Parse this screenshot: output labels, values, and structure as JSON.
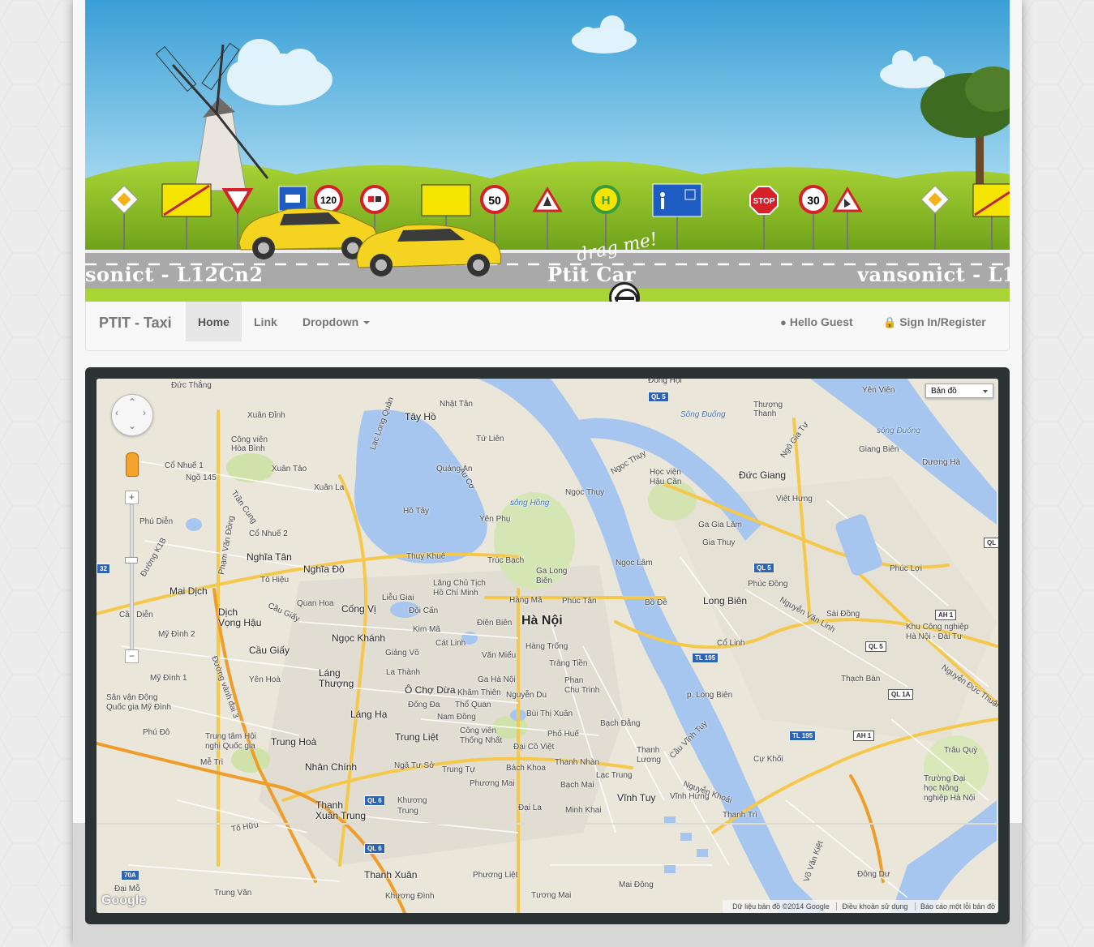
{
  "header": {
    "road_text_left": "sonict - L12Cn2",
    "road_text_mid": "Ptit Car",
    "road_text_right": "vansonict - L12",
    "drag_hint": "drag me!",
    "sign_labels": [
      "120",
      "50",
      "STOP",
      "30"
    ],
    "sign_label_h": "H"
  },
  "navbar": {
    "brand": "PTIT - Taxi",
    "items": [
      {
        "label": "Home",
        "active": true
      },
      {
        "label": "Link",
        "active": false
      },
      {
        "label": "Dropdown",
        "active": false
      }
    ],
    "right": [
      {
        "icon": "user-icon",
        "label": "Hello Guest"
      },
      {
        "icon": "lock-icon",
        "label": "Sign In/Register"
      }
    ]
  },
  "map": {
    "type_selector": "Bản đồ",
    "logo": "Google",
    "attribution": {
      "data": "Dữ liệu bản đồ ©2014 Google",
      "terms": "Điều khoản sử dụng",
      "report": "Báo cáo một lỗi bản đồ"
    },
    "labels": {
      "city": "Hà Nội",
      "long_bien": "Long Biên",
      "cau_giay": "Cầu Giấy",
      "tay_ho": "Tây Hồ",
      "duc_thang": "Đức Thắng",
      "xuan_dinh": "Xuân Đỉnh",
      "co_nhue": "Cổ Nhuế",
      "cong_vien_hoa_binh": "Công viên\nHòa Bình",
      "xuan_tao": "Xuân Tảo",
      "co_nhue_1": "Cổ Nhuế 1",
      "ngo_145": "Ngõ 145",
      "xuan_la": "Xuân La",
      "phu_dien": "Phú Diễn",
      "co_nhue_2": "Cổ Nhuế 2",
      "nghia_tan": "Nghĩa Tân",
      "nghia_do": "Nghĩa Đô",
      "to_hieu": "Tô Hiệu",
      "quan_hoa": "Quan Hoa",
      "cong_vi": "Cống Vị",
      "mai_dich": "Mai Dịch",
      "dich_vong_hau": "Dịch\nVọng Hậu",
      "cau_dien": "Cầu Diễn",
      "my_dinh_2": "Mỹ Đình 2",
      "my_dinh_1": "Mỹ Đình 1",
      "yen_hoa": "Yên Hoà",
      "svd_my_dinh": "Sân vận Động\nQuốc gia Mỹ Đình",
      "phu_do": "Phú Đô",
      "me_tri": "Mễ Trì",
      "trung_tam_hoi_nghi": "Trung tâm Hội\nnghị Quốc gia",
      "trung_hoa": "Trung Hoà",
      "nhan_chinh": "Nhân Chính",
      "thanh_xuan_trung": "Thanh\nXuân Trung",
      "thanh_xuan": "Thanh Xuân",
      "ngoc_khanh": "Ngọc Khánh",
      "giang_vo": "Giảng Võ",
      "lang_thuong": "Láng\nThượng",
      "la_thanh": "La Thành",
      "o_cho_dua": "Ô Chợ Dừa",
      "lang_ha": "Láng Hạ",
      "trung_liet": "Trung Liệt",
      "nga_tu_so": "Ngã Tư Sở",
      "trung_tu": "Trung Tự",
      "khuong_trung": "Khương\nTrung",
      "phuong_mai": "Phương Mai",
      "khuong_dinh": "Khương Đình",
      "phuong_liet": "Phương Liệt",
      "thuy_khue": "Thuỵ Khuê",
      "truc_bach": "Trúc Bạch",
      "lang_bac": "Lăng Chủ Tịch\nHồ Chí Minh",
      "lieu_giai": "Liễu Giai",
      "doi_can": "Đội Cấn",
      "kim_ma": "Kim Mã",
      "cat_linh": "Cát Linh",
      "dien_bien": "Điện Biên",
      "hang_ma": "Hàng Mã",
      "hang_trong": "Hàng Trống",
      "van_mieu": "Văn Miếu",
      "trang_tien": "Tràng Tiền",
      "ga_ha_noi": "Ga Hà Nội",
      "kham_thien": "Khâm Thiên",
      "nguyen_du": "Nguyễn Du",
      "tho_quan": "Thổ Quan",
      "nam_dong": "Nam Đồng",
      "bui_thi_xuan": "Bùi Thị Xuân",
      "phan_chu_trinh": "Phan\nChu Trinh",
      "pho_hue": "Phố Huế",
      "dong_da": "Đống Đa",
      "cong_vien_thong_nhat": "Công viên\nThống Nhất",
      "dai_co_viet": "Đại Cồ Việt",
      "bach_khoa": "Bách Khoa",
      "thanh_nhan": "Thanh Nhàn",
      "bach_mai": "Bạch Mai",
      "dai_la": "Đại La",
      "minh_khai": "Minh Khai",
      "lac_trung": "Lạc Trung",
      "vinh_tuy": "Vĩnh Tuy",
      "thanh_luong": "Thanh\nLương",
      "bach_dang": "Bạch Đằng",
      "ga_long_bien": "Ga Long\nBiên",
      "phuc_tan": "Phúc Tân",
      "yen_phu": "Yên Phụ",
      "quang_an": "Quảng An",
      "nhat_tan": "Nhật Tân",
      "tu_lien": "Tứ Liên",
      "ho_tay": "Hồ Tây",
      "ngoc_thuy": "Ngọc Thụy",
      "song_hong": "sông Hồng",
      "hoc_vien_hau_can": "Học viện\nHậu Cần",
      "duc_giang": "Đức Giang",
      "thuong_thanh": "Thượng\nThanh",
      "song_duong": "Sông Đuống",
      "song_duong_2": "sông Đuống",
      "giang_bien": "Giang Biên",
      "duong_ha": "Dương Hà",
      "yen_vien": "Yên Viên",
      "dong_hoi": "Đông Hội",
      "viet_hung": "Việt Hưng",
      "ga_gia_lam": "Ga Gia Lâm",
      "gia_thuy": "Gia Thuy",
      "ngoc_lam": "Ngọc Lâm",
      "phuc_dong": "Phúc Đồng",
      "bo_de": "Bồ Đề",
      "sai_dong": "Sài Đồng",
      "phuc_loi": "Phúc Lợi",
      "kcn_hanoi_dai_tu": "Khu Công nghiệp\nHà Nội - Đài Tư",
      "co_linh": "Cổ Linh",
      "thach_ban": "Thạch Bàn",
      "p_long_bien": "p. Long Biên",
      "cu_khoi": "Cự Khối",
      "trau_quy": "Trâu Quỳ",
      "dh_nong_nghiep": "Trường Đại\nhọc Nông\nnghiệp Hà Nội",
      "vinh_hung": "Vĩnh Hưng",
      "thanh_tri": "Thanh Trì",
      "mai_dong": "Mai Động",
      "tuong_mai": "Tương Mai",
      "dong_du": "Đông Dư",
      "nguyen_van_linh": "Nguyễn Văn Linh",
      "nguyen_duc_thuan": "Nguyễn Đức Thuận",
      "cau_vinh_tuy": "Cầu Vĩnh Tuy",
      "nguyen_khoai": "Nguyễn Khoái",
      "duong_vanh_dai_3": "Đường vành đai 3",
      "cau_giay_road": "Cầu Giấy",
      "to_huu": "Tố Hữu",
      "trung_van": "Trung Văn",
      "dai_mo": "Đại Mỗ",
      "lac_long_quan": "Lạc Long Quân",
      "au_co": "Âu Cơ",
      "tran_cung": "Trần Cung",
      "pham_van_dong": "Phạm Văn Đồng",
      "duong_k1b": "Đường K1B",
      "ngoc_thuy_road": "Ngọc Thụy",
      "ngo_gia_tu": "Ngô Gia Tự",
      "vo_van_kiet": "Võ Văn Kiệt"
    },
    "shields": [
      "QL 5",
      "QL 5",
      "TL 195",
      "TL 195",
      "AH 1",
      "QL 5",
      "QL 1A",
      "AH 1",
      "QL 6",
      "QL 6",
      "32",
      "70A",
      "QL"
    ]
  }
}
